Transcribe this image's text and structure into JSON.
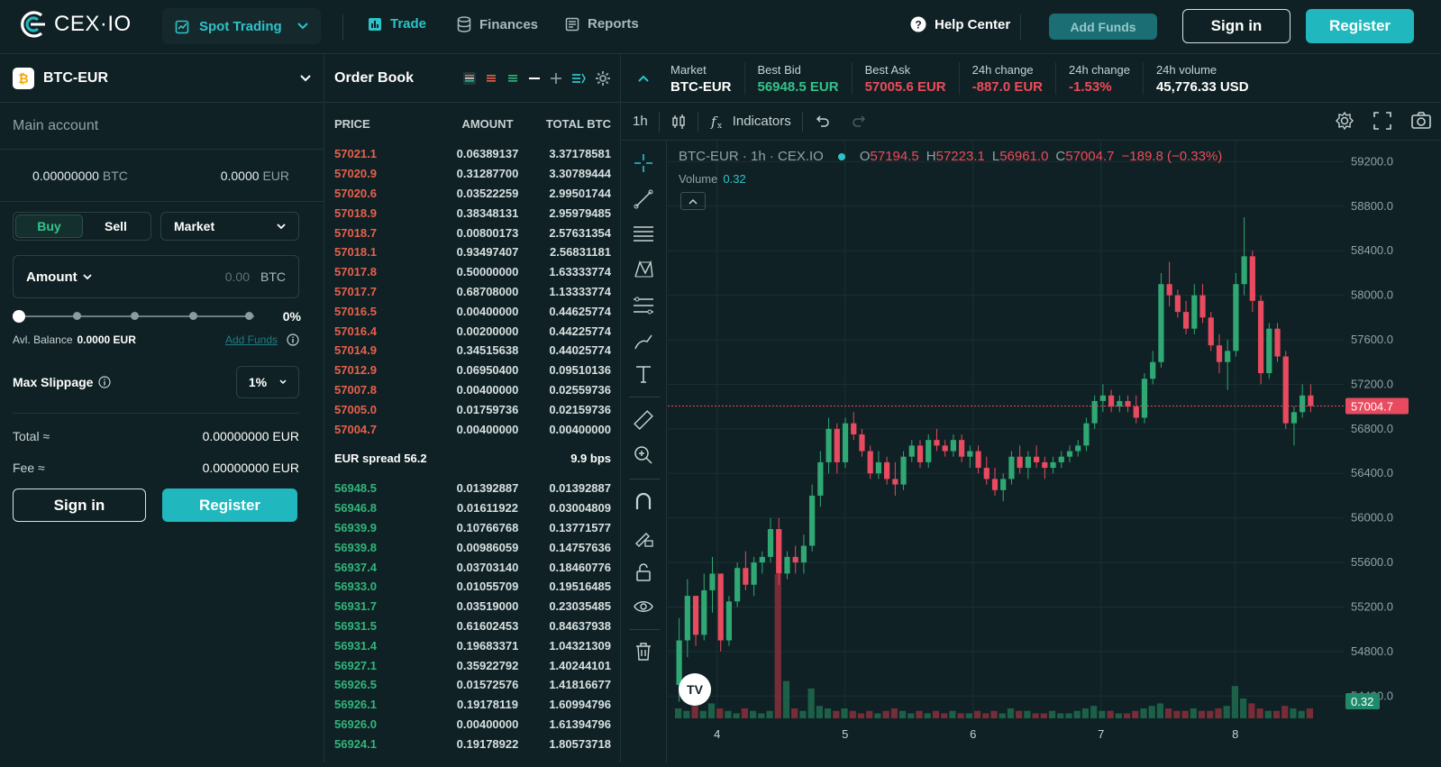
{
  "header": {
    "logo_text": "CEX·IO",
    "mode": "Spot Trading",
    "nav": [
      {
        "label": "Trade",
        "icon": "chart-bars-icon",
        "active": true
      },
      {
        "label": "Finances",
        "icon": "database-icon",
        "active": false
      },
      {
        "label": "Reports",
        "icon": "report-icon",
        "active": false
      }
    ],
    "help": "Help Center",
    "add_funds": "Add Funds",
    "sign_in": "Sign in",
    "register": "Register"
  },
  "left": {
    "pair": "BTC-EUR",
    "coin_glyph": "₿",
    "account": "Main account",
    "balance_btc": "0.00000000",
    "balance_btc_unit": "BTC",
    "balance_eur": "0.0000",
    "balance_eur_unit": "EUR",
    "buy": "Buy",
    "sell": "Sell",
    "order_type": "Market",
    "amount_label": "Amount",
    "amount_value": "0.00",
    "amount_unit": "BTC",
    "slider_pct": "0%",
    "slider_value": 0,
    "avl_label": "Avl. Balance",
    "avl_value": "0.0000 EUR",
    "add_funds": "Add Funds",
    "max_slippage_label": "Max Slippage",
    "max_slippage": "1%",
    "total_label": "Total ≈",
    "total_value": "0.00000000 EUR",
    "fee_label": "Fee ≈",
    "fee_value": "0.00000000 EUR",
    "sign_in": "Sign in",
    "register": "Register"
  },
  "orderbook": {
    "title": "Order Book",
    "cols": [
      "PRICE",
      "AMOUNT",
      "TOTAL BTC"
    ],
    "asks": [
      [
        "57021.1",
        "0.06389137",
        "3.37178581"
      ],
      [
        "57020.9",
        "0.31287700",
        "3.30789444"
      ],
      [
        "57020.6",
        "0.03522259",
        "2.99501744"
      ],
      [
        "57018.9",
        "0.38348131",
        "2.95979485"
      ],
      [
        "57018.7",
        "0.00800173",
        "2.57631354"
      ],
      [
        "57018.1",
        "0.93497407",
        "2.56831181"
      ],
      [
        "57017.8",
        "0.50000000",
        "1.63333774"
      ],
      [
        "57017.7",
        "0.68708000",
        "1.13333774"
      ],
      [
        "57016.5",
        "0.00400000",
        "0.44625774"
      ],
      [
        "57016.4",
        "0.00200000",
        "0.44225774"
      ],
      [
        "57014.9",
        "0.34515638",
        "0.44025774"
      ],
      [
        "57012.9",
        "0.06950400",
        "0.09510136"
      ],
      [
        "57007.8",
        "0.00400000",
        "0.02559736"
      ],
      [
        "57005.0",
        "0.01759736",
        "0.02159736"
      ],
      [
        "57004.7",
        "0.00400000",
        "0.00400000"
      ]
    ],
    "spread_label": "EUR spread 56.2",
    "spread_bps": "9.9 bps",
    "bids": [
      [
        "56948.5",
        "0.01392887",
        "0.01392887"
      ],
      [
        "56946.8",
        "0.01611922",
        "0.03004809"
      ],
      [
        "56939.9",
        "0.10766768",
        "0.13771577"
      ],
      [
        "56939.8",
        "0.00986059",
        "0.14757636"
      ],
      [
        "56937.4",
        "0.03703140",
        "0.18460776"
      ],
      [
        "56933.0",
        "0.01055709",
        "0.19516485"
      ],
      [
        "56931.7",
        "0.03519000",
        "0.23035485"
      ],
      [
        "56931.5",
        "0.61602453",
        "0.84637938"
      ],
      [
        "56931.4",
        "0.19683371",
        "1.04321309"
      ],
      [
        "56927.1",
        "0.35922792",
        "1.40244101"
      ],
      [
        "56926.5",
        "0.01572576",
        "1.41816677"
      ],
      [
        "56926.1",
        "0.19178119",
        "1.60994796"
      ],
      [
        "56926.0",
        "0.00400000",
        "1.61394796"
      ],
      [
        "56924.1",
        "0.19178922",
        "1.80573718"
      ]
    ]
  },
  "ticker": [
    {
      "label": "Market",
      "value": "BTC-EUR",
      "tone": "neutral"
    },
    {
      "label": "Best Bid",
      "value": "56948.5 EUR",
      "tone": "up"
    },
    {
      "label": "Best Ask",
      "value": "57005.6 EUR",
      "tone": "down"
    },
    {
      "label": "24h change",
      "value": "-887.0 EUR",
      "tone": "down"
    },
    {
      "label": "24h change",
      "value": "-1.53%",
      "tone": "down"
    },
    {
      "label": "24h volume",
      "value": "45,776.33 USD",
      "tone": "neutral"
    }
  ],
  "chart_toolbar": {
    "interval": "1h",
    "indicators": "Indicators"
  },
  "chart_data": {
    "type": "candlestick",
    "legend_title": "BTC-EUR · 1h · CEX.IO",
    "ohlc_labels": {
      "o": "O",
      "h": "H",
      "l": "L",
      "c": "C"
    },
    "ohlc_values": {
      "o": "57194.5",
      "h": "57223.1",
      "l": "56961.0",
      "c": "57004.7"
    },
    "change": "−189.8 (−0.33%)",
    "volume_label": "Volume",
    "volume_value": "0.32",
    "last_price": "57004.7",
    "volume_tag": "0.32",
    "ylim": [
      54200,
      59300
    ],
    "y_ticks": [
      "59200.0",
      "58800.0",
      "58400.0",
      "58000.0",
      "57600.0",
      "57200.0",
      "56800.0",
      "56400.0",
      "56000.0",
      "55600.0",
      "55200.0",
      "54800.0",
      "54400.0"
    ],
    "x_ticks": [
      "4",
      "5",
      "6",
      "7",
      "8"
    ],
    "candles": [
      [
        54500,
        55100,
        54350,
        54900
      ],
      [
        54900,
        55450,
        54750,
        55300
      ],
      [
        55300,
        55200,
        54850,
        54950
      ],
      [
        54950,
        55500,
        54900,
        55350
      ],
      [
        55350,
        55650,
        55150,
        55500
      ],
      [
        55500,
        55450,
        54800,
        54900
      ],
      [
        54900,
        55300,
        54850,
        55250
      ],
      [
        55250,
        55600,
        55200,
        55550
      ],
      [
        55550,
        55700,
        55350,
        55400
      ],
      [
        55400,
        55650,
        55300,
        55600
      ],
      [
        55600,
        55700,
        55500,
        55650
      ],
      [
        55650,
        56000,
        55600,
        55900
      ],
      [
        55900,
        56000,
        55400,
        55500
      ],
      [
        55500,
        55700,
        55450,
        55650
      ],
      [
        55650,
        55750,
        55500,
        55600
      ],
      [
        55600,
        55850,
        55500,
        55750
      ],
      [
        55750,
        56300,
        55700,
        56200
      ],
      [
        56200,
        56600,
        56100,
        56500
      ],
      [
        56500,
        56900,
        56400,
        56800
      ],
      [
        56800,
        56850,
        56400,
        56500
      ],
      [
        56500,
        56900,
        56450,
        56850
      ],
      [
        56850,
        56950,
        56700,
        56750
      ],
      [
        56750,
        56800,
        56550,
        56600
      ],
      [
        56600,
        56650,
        56350,
        56400
      ],
      [
        56400,
        56600,
        56350,
        56500
      ],
      [
        56500,
        56550,
        56300,
        56350
      ],
      [
        56350,
        56500,
        56200,
        56300
      ],
      [
        56300,
        56600,
        56250,
        56550
      ],
      [
        56550,
        56700,
        56500,
        56650
      ],
      [
        56650,
        56700,
        56450,
        56500
      ],
      [
        56500,
        56750,
        56450,
        56700
      ],
      [
        56700,
        56800,
        56600,
        56650
      ],
      [
        56650,
        56700,
        56550,
        56600
      ],
      [
        56600,
        56750,
        56550,
        56700
      ],
      [
        56700,
        56750,
        56500,
        56550
      ],
      [
        56550,
        56650,
        56450,
        56600
      ],
      [
        56600,
        56650,
        56400,
        56450
      ],
      [
        56450,
        56550,
        56300,
        56350
      ],
      [
        56350,
        56450,
        56200,
        56250
      ],
      [
        56250,
        56400,
        56150,
        56350
      ],
      [
        56350,
        56600,
        56300,
        56550
      ],
      [
        56550,
        56650,
        56400,
        56450
      ],
      [
        56450,
        56600,
        56350,
        56550
      ],
      [
        56550,
        56650,
        56450,
        56500
      ],
      [
        56500,
        56550,
        56350,
        56450
      ],
      [
        56450,
        56550,
        56400,
        56500
      ],
      [
        56500,
        56600,
        56450,
        56550
      ],
      [
        56550,
        56650,
        56500,
        56600
      ],
      [
        56600,
        56700,
        56550,
        56650
      ],
      [
        56650,
        56900,
        56600,
        56850
      ],
      [
        56850,
        57100,
        56800,
        57050
      ],
      [
        57050,
        57200,
        56950,
        57100
      ],
      [
        57100,
        57150,
        56950,
        57000
      ],
      [
        57000,
        57100,
        56950,
        57050
      ],
      [
        57050,
        57100,
        56950,
        57000
      ],
      [
        57000,
        57100,
        56850,
        56900
      ],
      [
        56900,
        57300,
        56850,
        57250
      ],
      [
        57250,
        57500,
        57200,
        57400
      ],
      [
        57400,
        58200,
        57350,
        58100
      ],
      [
        58100,
        58300,
        57900,
        58000
      ],
      [
        58000,
        58050,
        57800,
        57850
      ],
      [
        57850,
        57950,
        57650,
        57700
      ],
      [
        57700,
        58100,
        57650,
        58000
      ],
      [
        58000,
        58100,
        57750,
        57800
      ],
      [
        57800,
        57850,
        57500,
        57550
      ],
      [
        57550,
        57650,
        57300,
        57400
      ],
      [
        57400,
        57600,
        57150,
        57500
      ],
      [
        57500,
        58200,
        57450,
        58100
      ],
      [
        58100,
        58700,
        58000,
        58350
      ],
      [
        58350,
        58400,
        57850,
        57950
      ],
      [
        57950,
        58000,
        57200,
        57300
      ],
      [
        57300,
        57750,
        57250,
        57700
      ],
      [
        57700,
        57750,
        57400,
        57450
      ],
      [
        57450,
        57500,
        56800,
        56850
      ],
      [
        56850,
        57000,
        56650,
        56950
      ],
      [
        56950,
        57200,
        56900,
        57100
      ],
      [
        57100,
        57200,
        56950,
        57004.7
      ]
    ],
    "volumes": [
      0.4,
      0.3,
      0.5,
      0.3,
      0.6,
      0.4,
      0.3,
      0.2,
      0.4,
      0.3,
      0.2,
      0.3,
      5.8,
      1.5,
      0.4,
      0.3,
      1.2,
      0.5,
      0.4,
      0.3,
      0.4,
      0.3,
      0.2,
      0.3,
      0.2,
      0.3,
      0.4,
      0.3,
      0.2,
      0.3,
      0.2,
      0.3,
      0.2,
      0.3,
      0.2,
      0.2,
      0.3,
      0.2,
      0.3,
      0.2,
      0.4,
      0.3,
      0.3,
      0.2,
      0.2,
      0.3,
      0.2,
      0.2,
      0.3,
      0.4,
      0.5,
      0.3,
      0.3,
      0.2,
      0.2,
      0.3,
      0.4,
      0.5,
      0.6,
      0.4,
      0.3,
      0.3,
      0.4,
      0.3,
      0.3,
      0.4,
      0.5,
      1.3,
      0.8,
      0.6,
      0.4,
      0.3,
      0.3,
      0.5,
      0.4,
      0.3,
      0.4
    ]
  },
  "colors": {
    "up": "#2fa874",
    "down": "#e84a5f",
    "accent": "#20b8be",
    "background": "#0f2124"
  }
}
